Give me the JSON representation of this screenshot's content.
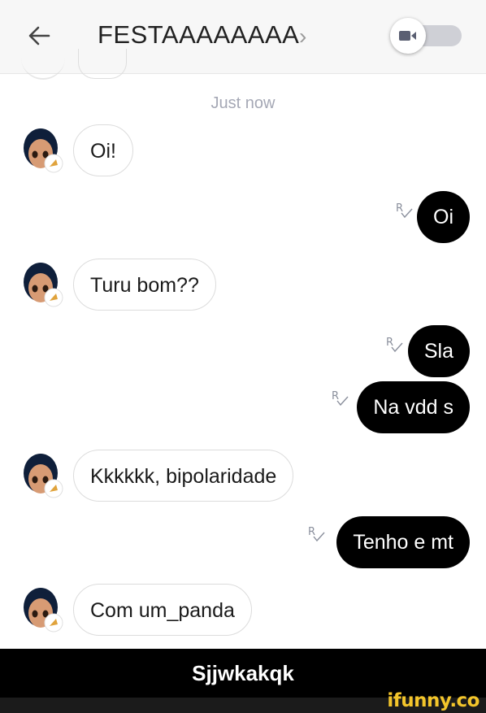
{
  "header": {
    "title": "FESTAAAAAAAA",
    "chevron": "›",
    "back_icon": "arrow-left-icon",
    "video_toggle_icon": "video-camera-icon"
  },
  "timestamp": "Just now",
  "messages": [
    {
      "side": "in",
      "text": "Oi!"
    },
    {
      "side": "out",
      "text": "Oi",
      "read": true
    },
    {
      "side": "in",
      "text": "Turu bom??"
    },
    {
      "side": "out",
      "text": "Sla",
      "read": true
    },
    {
      "side": "out",
      "text": "Na vdd s",
      "read": true
    },
    {
      "side": "in",
      "text": "Kkkkkk, bipolaridade"
    },
    {
      "side": "out",
      "text": "Tenho e mt",
      "read": true
    },
    {
      "side": "in",
      "text": "Com um_panda"
    }
  ],
  "caption": "Sjjwkakqk",
  "watermark": "ifunny.co",
  "colors": {
    "outgoing_bubble": "#000000",
    "incoming_bubble": "#ffffff",
    "timestamp": "#a5a8b5",
    "toggle_track": "#cfd0d6",
    "watermark": "#f3c52b"
  }
}
